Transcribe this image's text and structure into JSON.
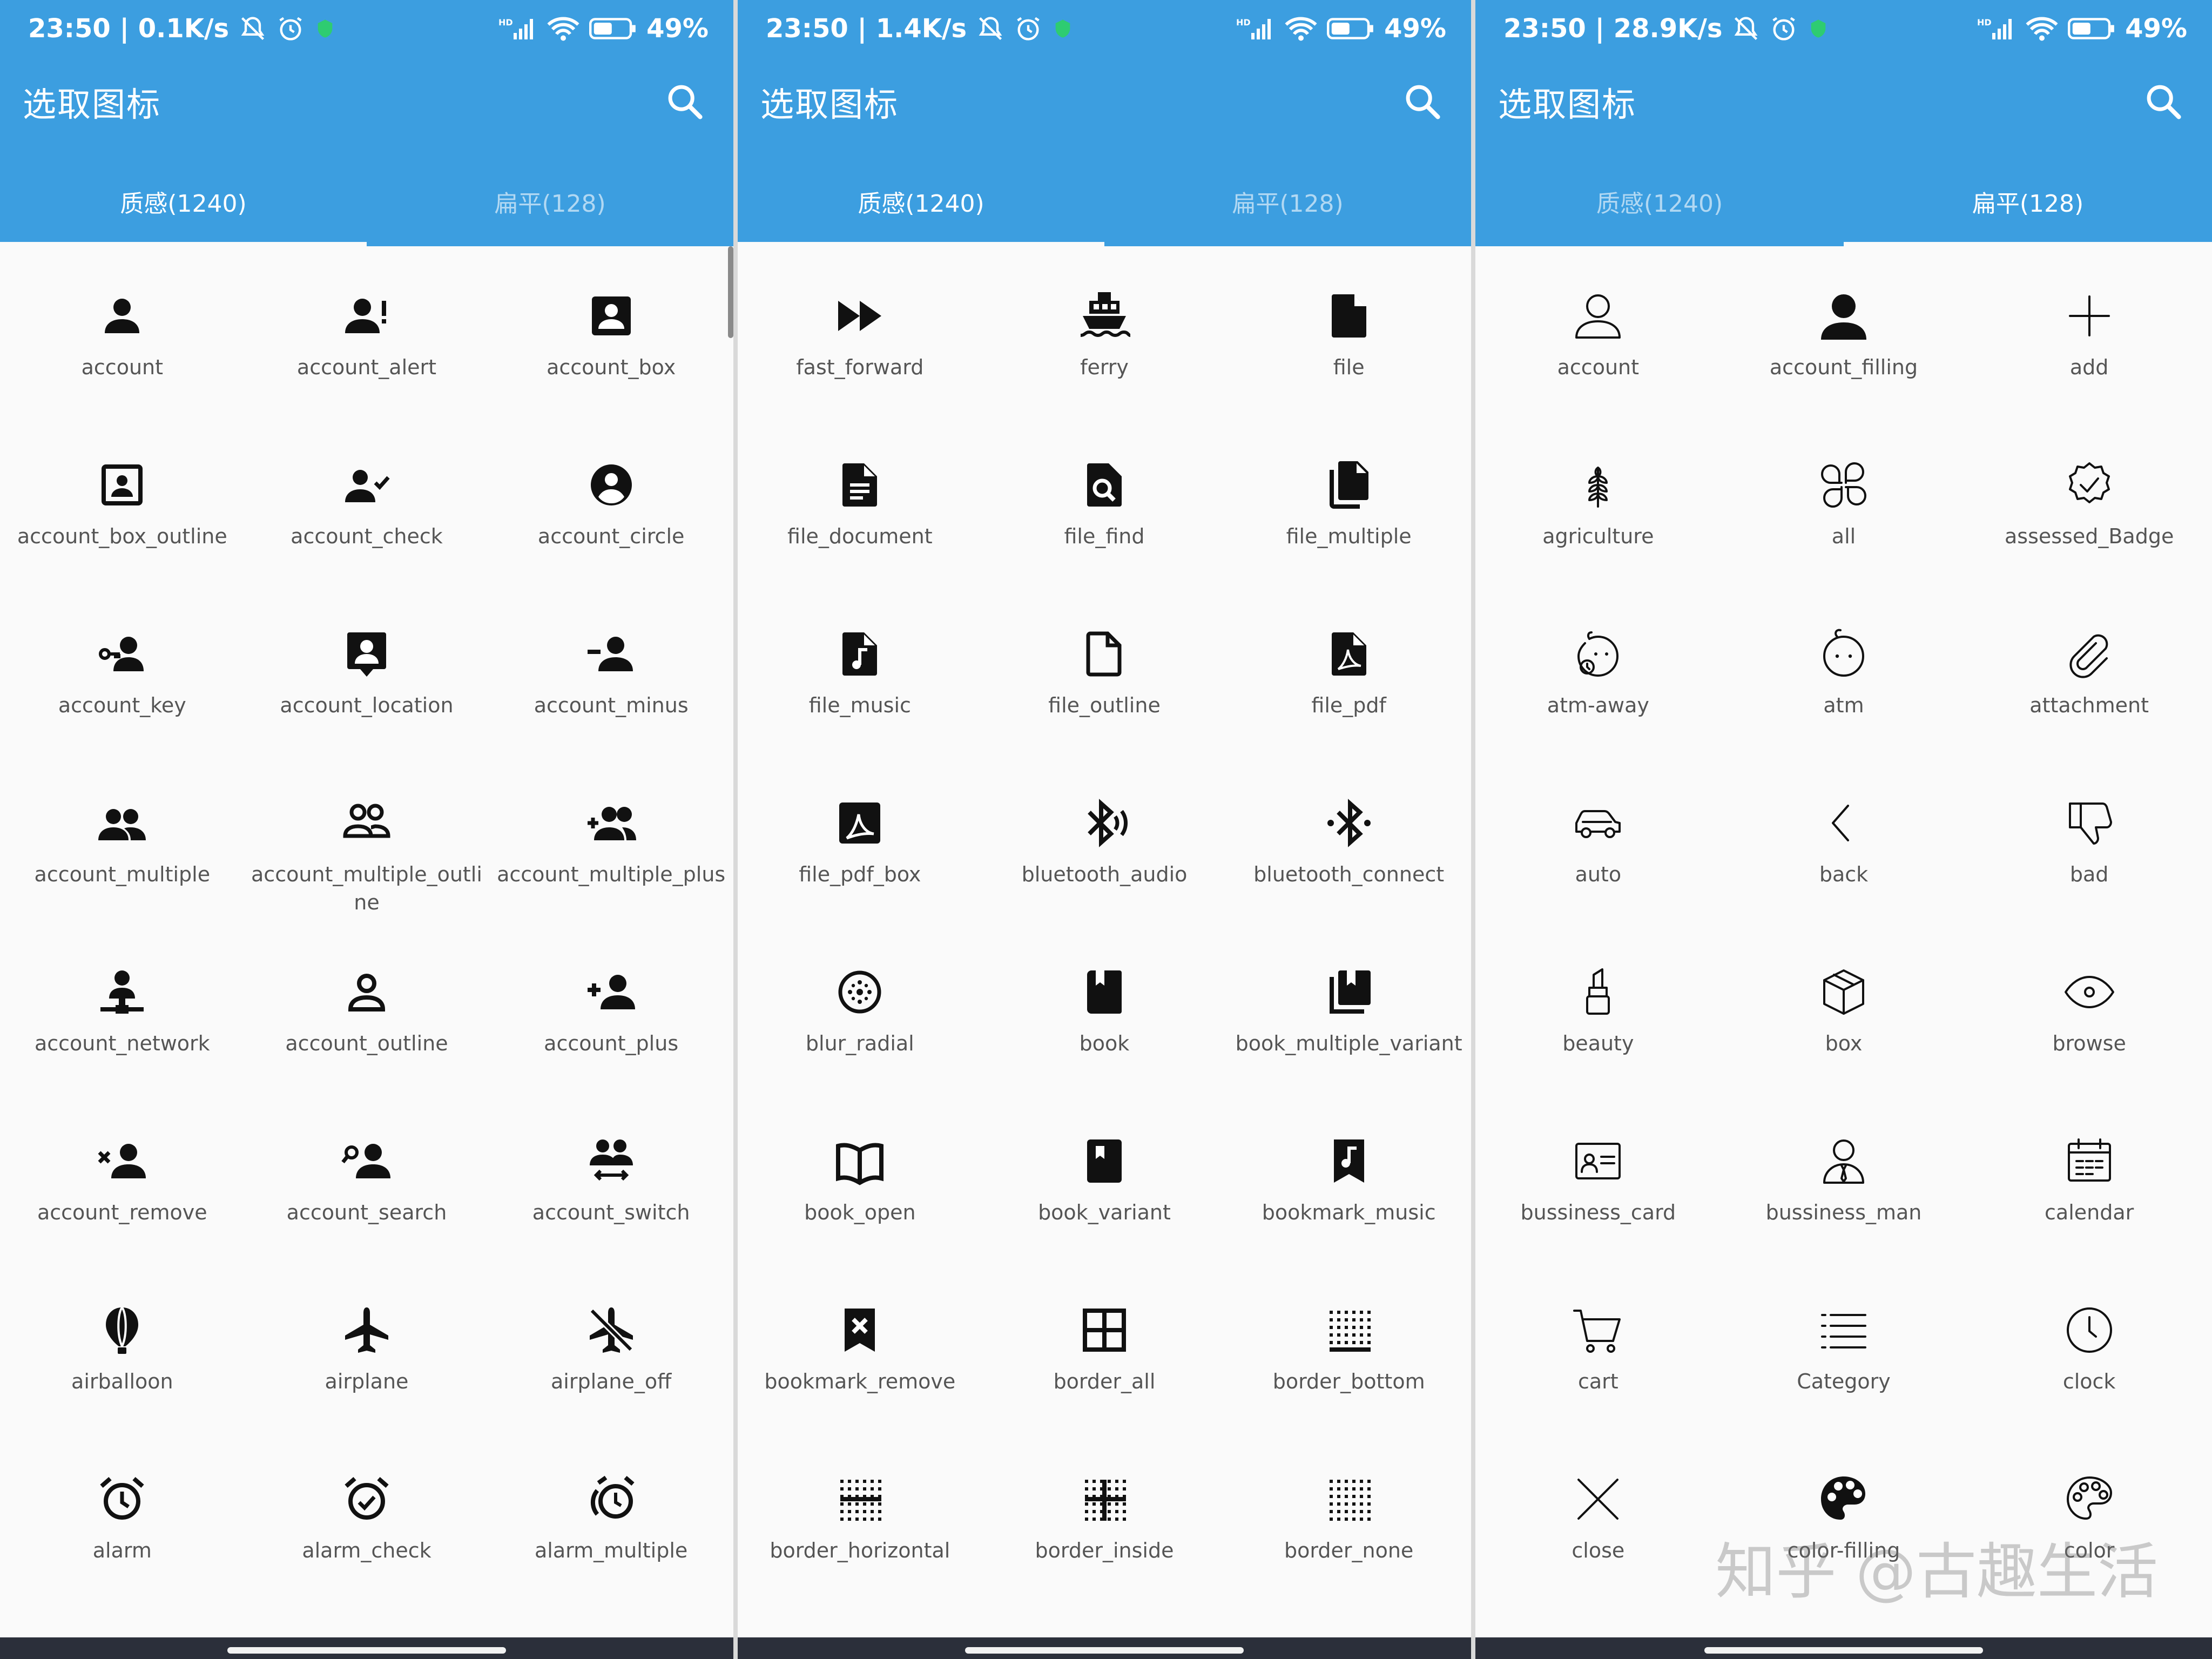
{
  "colors": {
    "header": "#3c9ee0",
    "background": "#fafafa",
    "icon": "#111111",
    "label": "#555555"
  },
  "panels": [
    {
      "status": {
        "time_speed": "23:50 | 0.1K/s",
        "battery": "49%"
      },
      "title": "选取图标",
      "tabs": [
        {
          "label": "质感(1240)",
          "active": true
        },
        {
          "label": "扁平(128)",
          "active": false
        }
      ],
      "icons": [
        {
          "label": "account",
          "icon": "person-icon"
        },
        {
          "label": "account_alert",
          "icon": "person-alert-icon"
        },
        {
          "label": "account_box",
          "icon": "account-box-icon"
        },
        {
          "label": "account_box_outline",
          "icon": "account-box-outline-icon"
        },
        {
          "label": "account_check",
          "icon": "person-check-icon"
        },
        {
          "label": "account_circle",
          "icon": "account-circle-icon"
        },
        {
          "label": "account_key",
          "icon": "person-key-icon"
        },
        {
          "label": "account_location",
          "icon": "account-location-icon"
        },
        {
          "label": "account_minus",
          "icon": "person-minus-icon"
        },
        {
          "label": "account_multiple",
          "icon": "people-icon"
        },
        {
          "label": "account_multiple_outline",
          "icon": "people-outline-icon"
        },
        {
          "label": "account_multiple_plus",
          "icon": "people-plus-icon"
        },
        {
          "label": "account_network",
          "icon": "person-network-icon"
        },
        {
          "label": "account_outline",
          "icon": "person-outline-icon"
        },
        {
          "label": "account_plus",
          "icon": "person-plus-icon"
        },
        {
          "label": "account_remove",
          "icon": "person-remove-icon"
        },
        {
          "label": "account_search",
          "icon": "person-search-icon"
        },
        {
          "label": "account_switch",
          "icon": "people-switch-icon"
        },
        {
          "label": "airballoon",
          "icon": "balloon-icon"
        },
        {
          "label": "airplane",
          "icon": "airplane-icon"
        },
        {
          "label": "airplane_off",
          "icon": "airplane-off-icon"
        },
        {
          "label": "alarm",
          "icon": "alarm-icon"
        },
        {
          "label": "alarm_check",
          "icon": "alarm-check-icon"
        },
        {
          "label": "alarm_multiple",
          "icon": "alarm-multiple-icon"
        }
      ]
    },
    {
      "status": {
        "time_speed": "23:50 | 1.4K/s",
        "battery": "49%"
      },
      "title": "选取图标",
      "tabs": [
        {
          "label": "质感(1240)",
          "active": true
        },
        {
          "label": "扁平(128)",
          "active": false
        }
      ],
      "icons": [
        {
          "label": "fast_forward",
          "icon": "fast-forward-icon"
        },
        {
          "label": "ferry",
          "icon": "ferry-icon"
        },
        {
          "label": "file",
          "icon": "file-icon"
        },
        {
          "label": "file_document",
          "icon": "file-document-icon"
        },
        {
          "label": "file_find",
          "icon": "file-find-icon"
        },
        {
          "label": "file_multiple",
          "icon": "file-multiple-icon"
        },
        {
          "label": "file_music",
          "icon": "file-music-icon"
        },
        {
          "label": "file_outline",
          "icon": "file-outline-icon"
        },
        {
          "label": "file_pdf",
          "icon": "file-pdf-icon"
        },
        {
          "label": "file_pdf_box",
          "icon": "file-pdf-box-icon"
        },
        {
          "label": "bluetooth_audio",
          "icon": "bluetooth-audio-icon"
        },
        {
          "label": "bluetooth_connect",
          "icon": "bluetooth-connect-icon"
        },
        {
          "label": "blur_radial",
          "icon": "blur-radial-icon"
        },
        {
          "label": "book",
          "icon": "book-icon"
        },
        {
          "label": "book_multiple_variant",
          "icon": "book-multiple-icon"
        },
        {
          "label": "book_open",
          "icon": "book-open-icon"
        },
        {
          "label": "book_variant",
          "icon": "book-variant-icon"
        },
        {
          "label": "bookmark_music",
          "icon": "bookmark-music-icon"
        },
        {
          "label": "bookmark_remove",
          "icon": "bookmark-remove-icon"
        },
        {
          "label": "border_all",
          "icon": "border-all-icon"
        },
        {
          "label": "border_bottom",
          "icon": "border-bottom-icon"
        },
        {
          "label": "border_horizontal",
          "icon": "border-horizontal-icon"
        },
        {
          "label": "border_inside",
          "icon": "border-inside-icon"
        },
        {
          "label": "border_none",
          "icon": "border-none-icon"
        }
      ]
    },
    {
      "status": {
        "time_speed": "23:50 | 28.9K/s",
        "battery": "49%"
      },
      "title": "选取图标",
      "tabs": [
        {
          "label": "质感(1240)",
          "active": false
        },
        {
          "label": "扁平(128)",
          "active": true
        }
      ],
      "icons": [
        {
          "label": "account",
          "icon": "person-line-icon"
        },
        {
          "label": "account_filling",
          "icon": "person-filled-icon"
        },
        {
          "label": "add",
          "icon": "plus-icon"
        },
        {
          "label": "agriculture",
          "icon": "wheat-icon"
        },
        {
          "label": "all",
          "icon": "four-leaf-icon"
        },
        {
          "label": "assessed_Badge",
          "icon": "badge-check-icon"
        },
        {
          "label": "atm-away",
          "icon": "face-away-icon"
        },
        {
          "label": "atm",
          "icon": "face-icon"
        },
        {
          "label": "attachment",
          "icon": "paperclip-icon"
        },
        {
          "label": "auto",
          "icon": "car-icon"
        },
        {
          "label": "back",
          "icon": "chevron-left-icon"
        },
        {
          "label": "bad",
          "icon": "thumbs-down-icon"
        },
        {
          "label": "beauty",
          "icon": "lipstick-icon"
        },
        {
          "label": "box",
          "icon": "box-icon"
        },
        {
          "label": "browse",
          "icon": "eye-icon"
        },
        {
          "label": "bussiness_card",
          "icon": "card-icon"
        },
        {
          "label": "bussiness_man",
          "icon": "businessman-icon"
        },
        {
          "label": "calendar",
          "icon": "calendar-icon"
        },
        {
          "label": "cart",
          "icon": "cart-icon"
        },
        {
          "label": "Category",
          "icon": "list-icon"
        },
        {
          "label": "clock",
          "icon": "clock-icon"
        },
        {
          "label": "close",
          "icon": "close-icon"
        },
        {
          "label": "color-filling",
          "icon": "palette-filled-icon"
        },
        {
          "label": "color",
          "icon": "palette-icon"
        }
      ]
    }
  ],
  "watermark": "知乎 @古趣生活"
}
